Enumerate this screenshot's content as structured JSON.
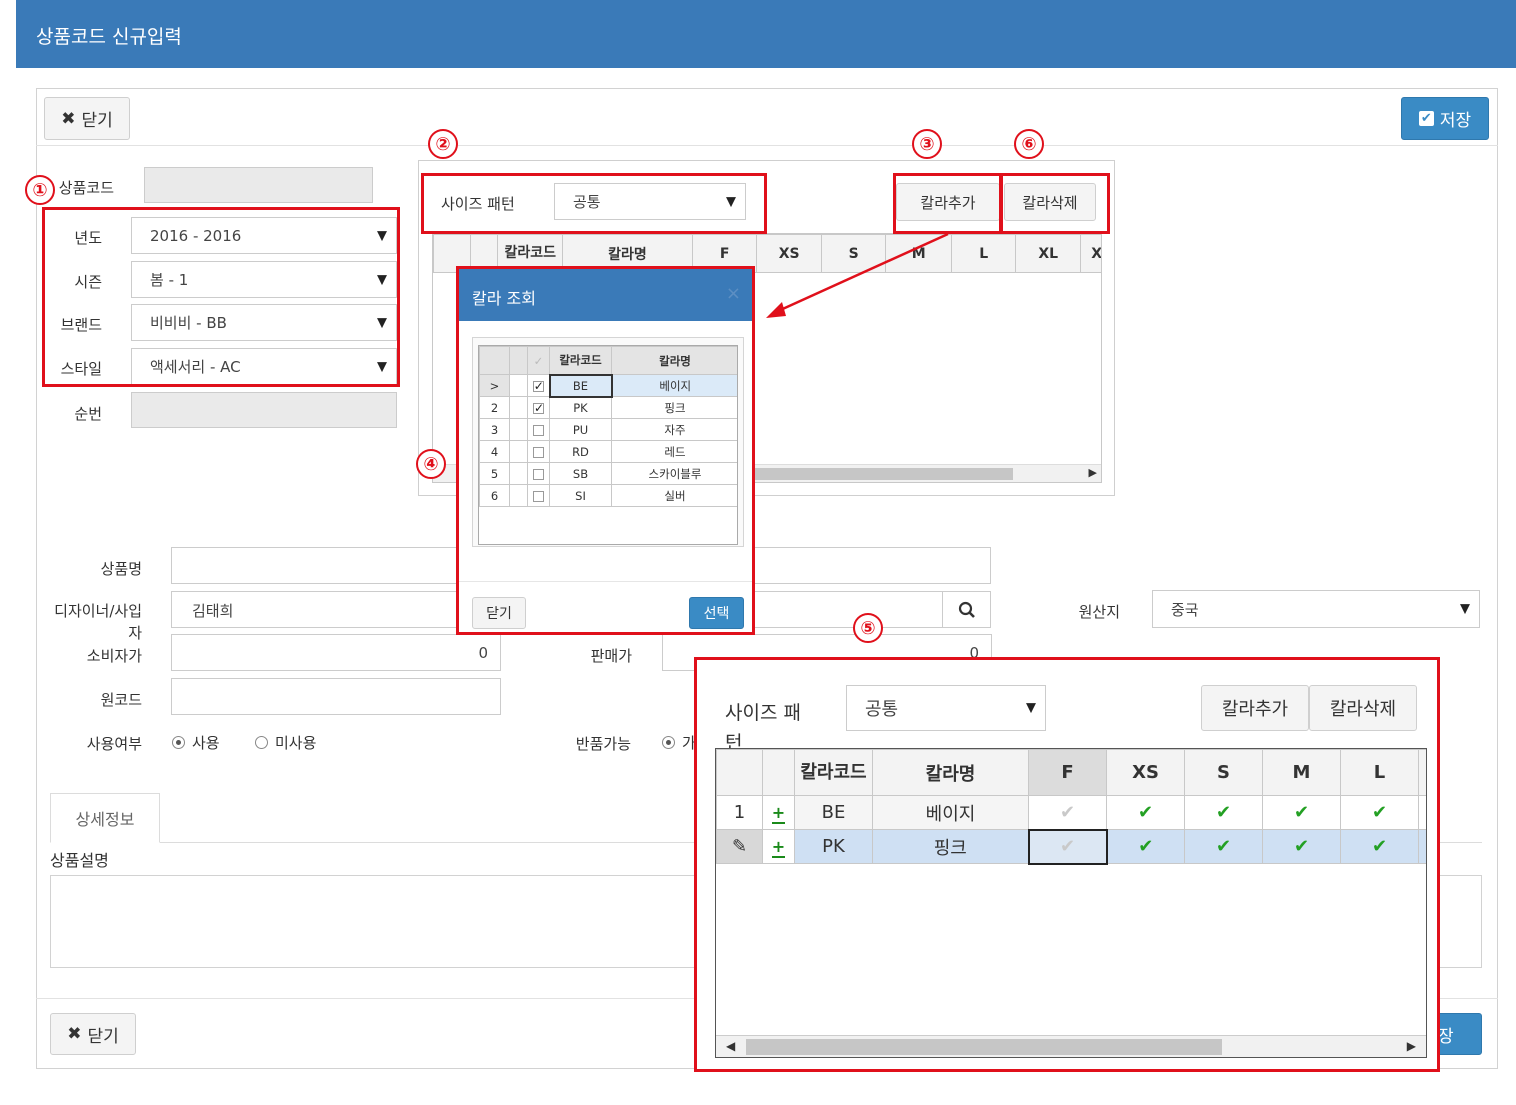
{
  "window_title": "상품코드 신규입력",
  "toolbar": {
    "close_label": "닫기",
    "save_label": "저장"
  },
  "form": {
    "product_code_label": "상품코드",
    "year_label": "년도",
    "year_value": "2016 - 2016",
    "season_label": "시즌",
    "season_value": "봄 - 1",
    "brand_label": "브랜드",
    "brand_value": "비비비 - BB",
    "style_label": "스타일",
    "style_value": "액세서리 - AC",
    "seq_label": "순번",
    "product_name_label": "상품명",
    "designer_label": "디자이너/사입자",
    "designer_value": "김태희",
    "origin_label": "원산지",
    "origin_value": "중국",
    "consumer_price_label": "소비자가",
    "consumer_price_value": "0",
    "sale_price_label": "판매가",
    "sale_price_value": "0",
    "raw_code_label": "원코드",
    "use_label": "사용여부",
    "use_option_yes": "사용",
    "use_option_no": "미사용",
    "return_label": "반품가능",
    "return_option_yes": "가"
  },
  "tabs": {
    "detail_tab": "상세정보",
    "description_label": "상품설명"
  },
  "size_panel": {
    "pattern_label": "사이즈 패턴",
    "pattern_value": "공통",
    "add_color": "칼라추가",
    "delete_color": "칼라삭제",
    "columns": [
      "칼라코드",
      "칼라명",
      "F",
      "XS",
      "S",
      "M",
      "L",
      "XL",
      "XXL"
    ]
  },
  "color_dialog": {
    "title": "칼라 조회",
    "close_x": "×",
    "col_code": "칼라코드",
    "col_name": "칼라명",
    "rows": [
      {
        "no": ">",
        "checked": true,
        "code": "BE",
        "name": "베이지"
      },
      {
        "no": "2",
        "checked": true,
        "code": "PK",
        "name": "핑크"
      },
      {
        "no": "3",
        "checked": false,
        "code": "PU",
        "name": "자주"
      },
      {
        "no": "4",
        "checked": false,
        "code": "RD",
        "name": "레드"
      },
      {
        "no": "5",
        "checked": false,
        "code": "SB",
        "name": "스카이블루"
      },
      {
        "no": "6",
        "checked": false,
        "code": "SI",
        "name": "실버"
      }
    ],
    "close_button": "닫기",
    "select_button": "선택"
  },
  "zoom_panel": {
    "pattern_label": "사이즈 패턴",
    "pattern_value": "공통",
    "add_color": "칼라추가",
    "delete_color": "칼라삭제",
    "columns": [
      "칼라코드",
      "칼라명",
      "F",
      "XS",
      "S",
      "M",
      "L"
    ],
    "rows": [
      {
        "no": "1",
        "code": "BE",
        "name": "베이지"
      },
      {
        "no": "",
        "code": "PK",
        "name": "핑크"
      }
    ]
  },
  "markers": [
    "①",
    "②",
    "③",
    "④",
    "⑤",
    "⑥"
  ],
  "colors": {
    "header": "#3a7ab8",
    "annotation": "#e0101b",
    "check": "#23a023"
  }
}
